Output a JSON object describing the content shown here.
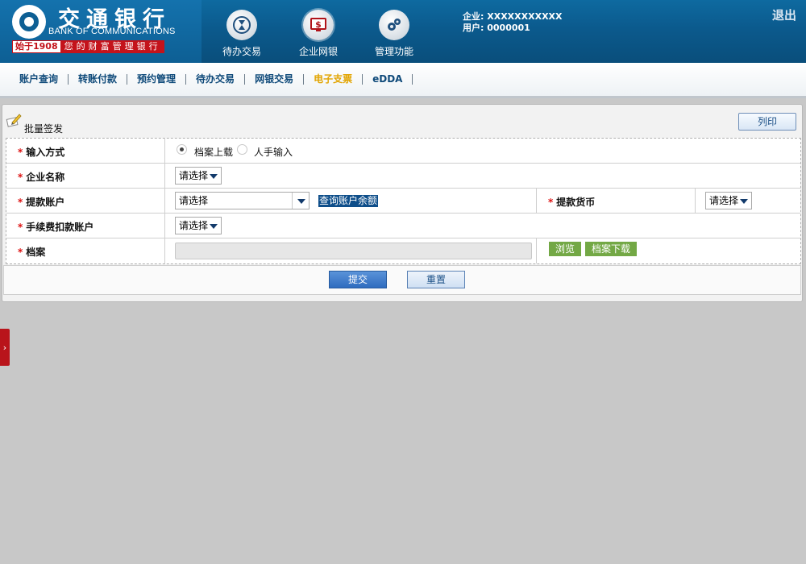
{
  "brand": {
    "name_cn": "交通银行",
    "name_en": "BANK OF COMMUNICATIONS",
    "since": "始于1908",
    "slogan": "您的财富管理银行"
  },
  "top_nav": [
    {
      "label": "待办交易",
      "icon": "hourglass-icon"
    },
    {
      "label": "企业网银",
      "icon": "monitor-dollar-icon"
    },
    {
      "label": "管理功能",
      "icon": "gears-icon"
    }
  ],
  "user": {
    "company": "企业: XXXXXXXXXXX",
    "user": "用户: 0000001"
  },
  "logout_label": "退出",
  "menu": [
    {
      "label": "账户查询"
    },
    {
      "label": "转账付款"
    },
    {
      "label": "预约管理"
    },
    {
      "label": "待办交易"
    },
    {
      "label": "网银交易"
    },
    {
      "label": "电子支票",
      "active": true
    },
    {
      "label": "eDDA"
    }
  ],
  "panel": {
    "title": "批量签发",
    "print_label": "列印"
  },
  "form": {
    "input_method": {
      "label": "输入方式",
      "options": [
        "档案上载",
        "人手输入"
      ],
      "selected": "档案上载"
    },
    "company_name": {
      "label": "企业名称",
      "value": "请选择"
    },
    "withdraw_account": {
      "label": "提款账户",
      "value": "请选择",
      "query_link": "查询账户余额"
    },
    "withdraw_currency": {
      "label": "提款货币",
      "value": "请选择"
    },
    "fee_account": {
      "label": "手续费扣款账户",
      "value": "请选择"
    },
    "file": {
      "label": "档案",
      "browse_label": "浏览",
      "download_label": "档案下载"
    }
  },
  "actions": {
    "submit_label": "提交",
    "reset_label": "重置"
  },
  "colors": {
    "header": "#0b5a8d",
    "menu_active": "#e2a400",
    "required_star": "#d11111",
    "brand_red": "#c4131b",
    "green_button": "#73a845"
  }
}
